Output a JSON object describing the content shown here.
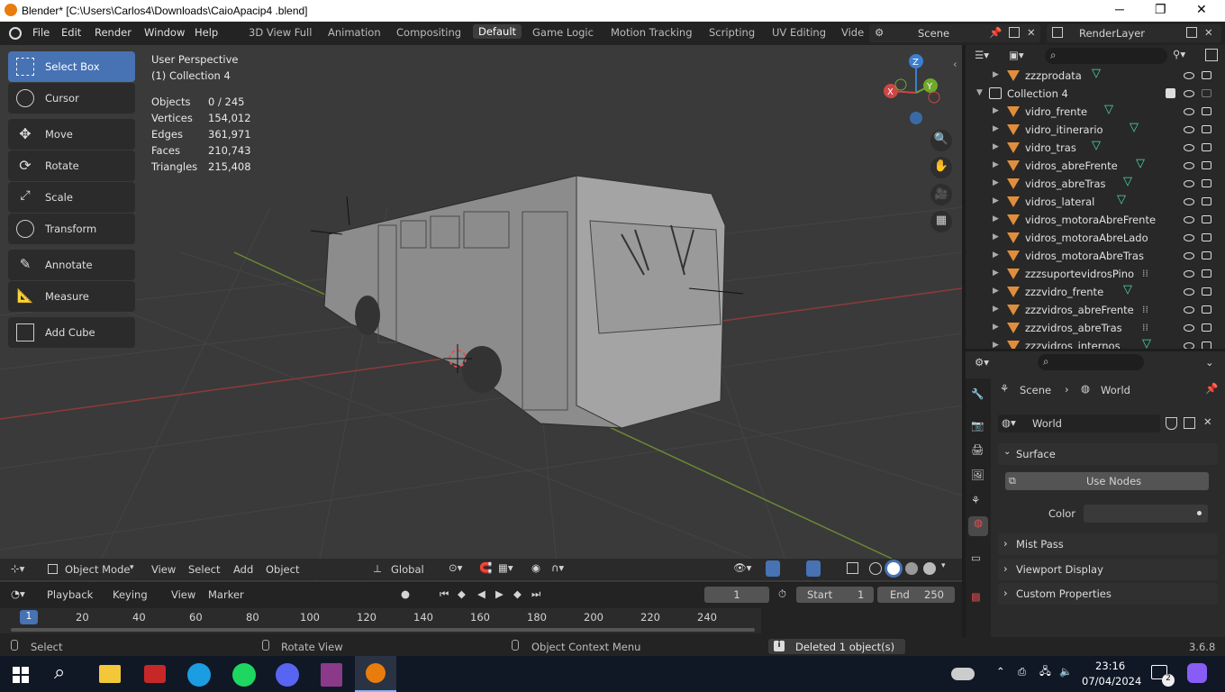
{
  "window": {
    "title": "Blender* [C:\\Users\\Carlos4\\Downloads\\CaioApacip4 .blend]",
    "minimize": "─",
    "maximize": "❐",
    "close": "✕"
  },
  "menu": [
    "File",
    "Edit",
    "Render",
    "Window",
    "Help"
  ],
  "workspaces": [
    "3D View Full",
    "Animation",
    "Compositing",
    "Default",
    "Game Logic",
    "Motion Tracking",
    "Scripting",
    "UV Editing",
    "Vide"
  ],
  "active_workspace": "Default",
  "scene": {
    "label": "Scene",
    "render_layer": "RenderLayer"
  },
  "tools": [
    {
      "label": "Select Box",
      "icon": "select-box-icon",
      "selected": true
    },
    {
      "label": "Cursor",
      "icon": "cursor-icon"
    },
    {
      "label": "Move",
      "icon": "move-icon"
    },
    {
      "label": "Rotate",
      "icon": "rotate-icon"
    },
    {
      "label": "Scale",
      "icon": "scale-icon"
    },
    {
      "label": "Transform",
      "icon": "transform-icon"
    },
    {
      "label": "Annotate",
      "icon": "annotate-icon"
    },
    {
      "label": "Measure",
      "icon": "measure-icon"
    },
    {
      "label": "Add Cube",
      "icon": "add-cube-icon"
    }
  ],
  "overlay": {
    "perspective": "User Perspective",
    "collection": "(1) Collection 4",
    "stats": [
      {
        "label": "Objects",
        "value": "0 / 245"
      },
      {
        "label": "Vertices",
        "value": "154,012"
      },
      {
        "label": "Edges",
        "value": "361,971"
      },
      {
        "label": "Faces",
        "value": "210,743"
      },
      {
        "label": "Triangles",
        "value": "215,408"
      }
    ]
  },
  "gizmo": {
    "z": "Z",
    "y": "Y",
    "x": "X"
  },
  "header3d": {
    "mode": "Object Mode",
    "menus": [
      "View",
      "Select",
      "Add",
      "Object"
    ],
    "orientation": "Global"
  },
  "timeline": {
    "menus": [
      "Playback",
      "Keying",
      "View",
      "Marker"
    ],
    "current_frame": "1",
    "start_label": "Start",
    "start": "1",
    "end_label": "End",
    "end": "250",
    "ticks": [
      "1",
      "20",
      "40",
      "60",
      "80",
      "100",
      "120",
      "140",
      "160",
      "180",
      "200",
      "220",
      "240"
    ]
  },
  "status": {
    "select": "Select",
    "rotate": "Rotate View",
    "context": "Object Context Menu",
    "message": "Deleted 1 object(s)",
    "version": "3.6.8"
  },
  "outliner": {
    "rows": [
      {
        "name": "zzzprodata",
        "indent": 1,
        "icon": "mesh"
      },
      {
        "name": "Collection 4",
        "indent": 0,
        "icon": "collection"
      },
      {
        "name": "vidro_frente",
        "indent": 1,
        "icon": "mesh"
      },
      {
        "name": "vidro_itinerario",
        "indent": 1,
        "icon": "mesh"
      },
      {
        "name": "vidro_tras",
        "indent": 1,
        "icon": "mesh"
      },
      {
        "name": "vidros_abreFrente",
        "indent": 1,
        "icon": "mesh"
      },
      {
        "name": "vidros_abreTras",
        "indent": 1,
        "icon": "mesh"
      },
      {
        "name": "vidros_lateral",
        "indent": 1,
        "icon": "mesh"
      },
      {
        "name": "vidros_motoraAbreFrente",
        "indent": 1,
        "icon": "none"
      },
      {
        "name": "vidros_motoraAbreLado",
        "indent": 1,
        "icon": "none"
      },
      {
        "name": "vidros_motoraAbreTras",
        "indent": 1,
        "icon": "none"
      },
      {
        "name": "zzzsuportevidrosPino",
        "indent": 1,
        "icon": "modifier"
      },
      {
        "name": "zzzvidro_frente",
        "indent": 1,
        "icon": "mesh"
      },
      {
        "name": "zzzvidros_abreFrente",
        "indent": 1,
        "icon": "modifier"
      },
      {
        "name": "zzzvidros_abreTras",
        "indent": 1,
        "icon": "modifier"
      },
      {
        "name": "zzzvidros_internos",
        "indent": 1,
        "icon": "mesh"
      }
    ]
  },
  "properties": {
    "breadcrumb_scene": "Scene",
    "breadcrumb_world": "World",
    "world_name": "World",
    "sections": [
      "Surface",
      "Mist Pass",
      "Viewport Display",
      "Custom Properties"
    ],
    "use_nodes": "Use Nodes",
    "color_label": "Color"
  },
  "taskbar": {
    "time": "23:16",
    "date": "07/04/2024",
    "notifications": "2"
  }
}
